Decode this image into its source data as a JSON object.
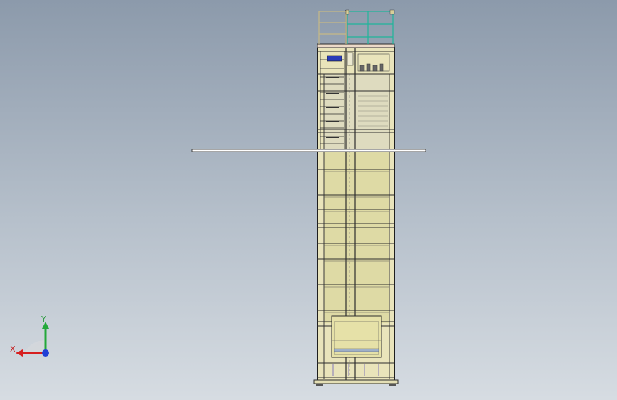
{
  "viewport": {
    "background_top": "#8c9aab",
    "background_bottom": "#d6dce2"
  },
  "model": {
    "name": "tower-elevator-assembly",
    "edge_color": "#2d2d2d",
    "frame_fill": "#f2edc7",
    "shaft_fill": "#d7d49a",
    "railing_color": "#1fb59a",
    "accent_blue": "#2a3cb8"
  },
  "triad": {
    "x_label": "X",
    "y_label": "Y",
    "x_color": "#d61f1f",
    "y_color": "#23a83a",
    "z_color": "#1f3fd6"
  }
}
